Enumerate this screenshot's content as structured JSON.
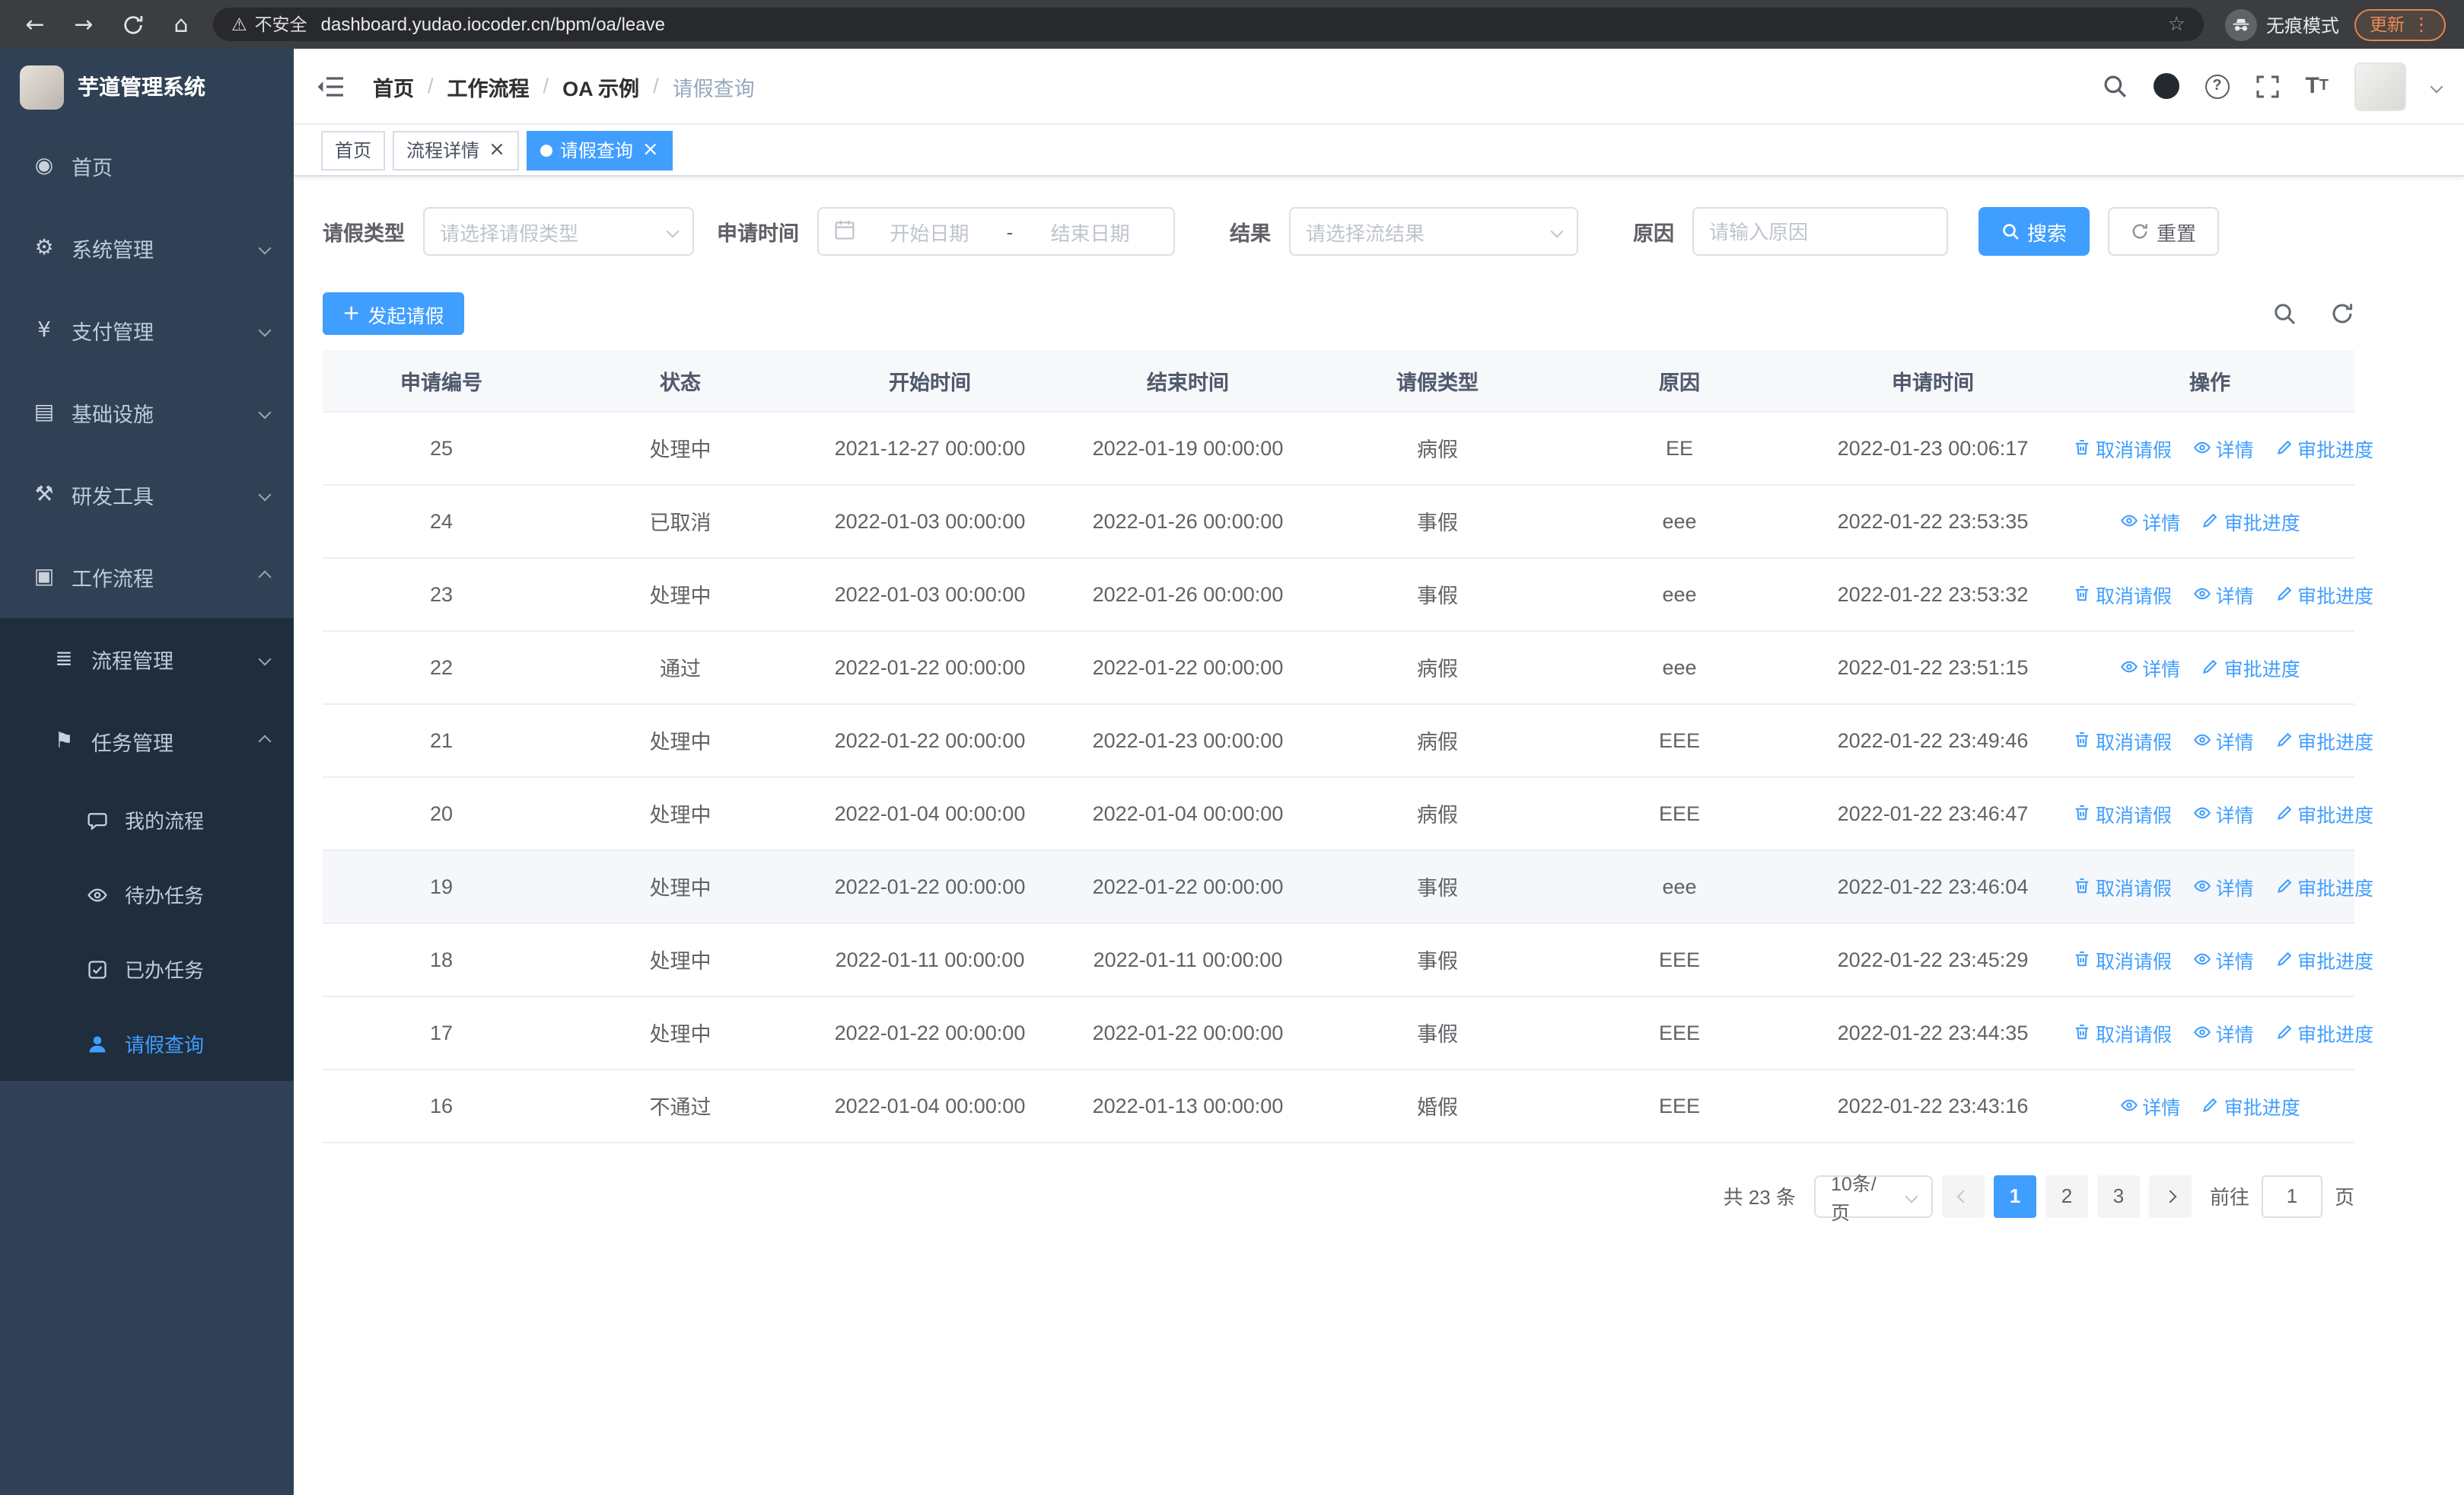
{
  "browser": {
    "security_warning": "不安全",
    "url": "dashboard.yudao.iocoder.cn/bpm/oa/leave",
    "incognito_label": "无痕模式",
    "update_button": "更新"
  },
  "icons": {
    "dashboard": "◉",
    "gear": "⚙",
    "yen": "¥",
    "infra": "▤",
    "tools": "⚒",
    "workflow": "▣",
    "list": "≣",
    "flag": "⚑",
    "warning": "⚠",
    "home": "⌂",
    "back": "←",
    "forward": "→",
    "star": "☆",
    "dots": "⋮",
    "close": "×",
    "plus": "+",
    "help": "?"
  },
  "sidebar": {
    "logo_title": "芋道管理系统",
    "items": [
      {
        "label": "首页"
      },
      {
        "label": "系统管理"
      },
      {
        "label": "支付管理"
      },
      {
        "label": "基础设施"
      },
      {
        "label": "研发工具"
      },
      {
        "label": "工作流程"
      }
    ],
    "process_group": {
      "label": "流程管理"
    },
    "task_group": {
      "label": "任务管理"
    },
    "task_items": [
      {
        "label": "我的流程"
      },
      {
        "label": "待办任务"
      },
      {
        "label": "已办任务"
      },
      {
        "label": "请假查询",
        "active": true
      }
    ]
  },
  "navbar": {
    "breadcrumb": [
      {
        "label": "首页"
      },
      {
        "label": "工作流程"
      },
      {
        "label": "OA 示例"
      },
      {
        "label": "请假查询"
      }
    ]
  },
  "tags": [
    {
      "label": "首页"
    },
    {
      "label": "流程详情"
    },
    {
      "label": "请假查询"
    }
  ],
  "filters": {
    "leave_type_label": "请假类型",
    "leave_type_placeholder": "请选择请假类型",
    "apply_time_label": "申请时间",
    "start_date_placeholder": "开始日期",
    "end_date_placeholder": "结束日期",
    "range_separator": "-",
    "result_label": "结果",
    "result_placeholder": "请选择流结果",
    "reason_label": "原因",
    "reason_placeholder": "请输入原因",
    "search_button": "搜索",
    "reset_button": "重置"
  },
  "toolbar": {
    "create_button": "发起请假"
  },
  "table": {
    "columns": [
      "申请编号",
      "状态",
      "开始时间",
      "结束时间",
      "请假类型",
      "原因",
      "申请时间",
      "操作"
    ],
    "action_labels": {
      "cancel": "取消请假",
      "detail": "详情",
      "progress": "审批进度"
    },
    "rows": [
      {
        "id": "25",
        "status": "处理中",
        "start": "2021-12-27 00:00:00",
        "end": "2022-01-19 00:00:00",
        "type": "病假",
        "reason": "EE",
        "apply": "2022-01-23 00:06:17",
        "cancellable": true
      },
      {
        "id": "24",
        "status": "已取消",
        "start": "2022-01-03 00:00:00",
        "end": "2022-01-26 00:00:00",
        "type": "事假",
        "reason": "eee",
        "apply": "2022-01-22 23:53:35",
        "cancellable": false
      },
      {
        "id": "23",
        "status": "处理中",
        "start": "2022-01-03 00:00:00",
        "end": "2022-01-26 00:00:00",
        "type": "事假",
        "reason": "eee",
        "apply": "2022-01-22 23:53:32",
        "cancellable": true
      },
      {
        "id": "22",
        "status": "通过",
        "start": "2022-01-22 00:00:00",
        "end": "2022-01-22 00:00:00",
        "type": "病假",
        "reason": "eee",
        "apply": "2022-01-22 23:51:15",
        "cancellable": false
      },
      {
        "id": "21",
        "status": "处理中",
        "start": "2022-01-22 00:00:00",
        "end": "2022-01-23 00:00:00",
        "type": "病假",
        "reason": "EEE",
        "apply": "2022-01-22 23:49:46",
        "cancellable": true
      },
      {
        "id": "20",
        "status": "处理中",
        "start": "2022-01-04 00:00:00",
        "end": "2022-01-04 00:00:00",
        "type": "病假",
        "reason": "EEE",
        "apply": "2022-01-22 23:46:47",
        "cancellable": true
      },
      {
        "id": "19",
        "status": "处理中",
        "start": "2022-01-22 00:00:00",
        "end": "2022-01-22 00:00:00",
        "type": "事假",
        "reason": "eee",
        "apply": "2022-01-22 23:46:04",
        "cancellable": true,
        "highlighted": true
      },
      {
        "id": "18",
        "status": "处理中",
        "start": "2022-01-11 00:00:00",
        "end": "2022-01-11 00:00:00",
        "type": "事假",
        "reason": "EEE",
        "apply": "2022-01-22 23:45:29",
        "cancellable": true
      },
      {
        "id": "17",
        "status": "处理中",
        "start": "2022-01-22 00:00:00",
        "end": "2022-01-22 00:00:00",
        "type": "事假",
        "reason": "EEE",
        "apply": "2022-01-22 23:44:35",
        "cancellable": true
      },
      {
        "id": "16",
        "status": "不通过",
        "start": "2022-01-04 00:00:00",
        "end": "2022-01-13 00:00:00",
        "type": "婚假",
        "reason": "EEE",
        "apply": "2022-01-22 23:43:16",
        "cancellable": false
      }
    ]
  },
  "pagination": {
    "total_text": "共 23 条",
    "page_size": "10条/页",
    "pages": [
      "1",
      "2",
      "3"
    ],
    "active_page": "1",
    "goto_prefix": "前往",
    "goto_value": "1",
    "goto_suffix": "页"
  },
  "colors": {
    "primary": "#409eff",
    "sidebar_bg": "#304156",
    "sidebar_submenu_bg": "#1f2d3d",
    "active_tag": "#409eff"
  }
}
